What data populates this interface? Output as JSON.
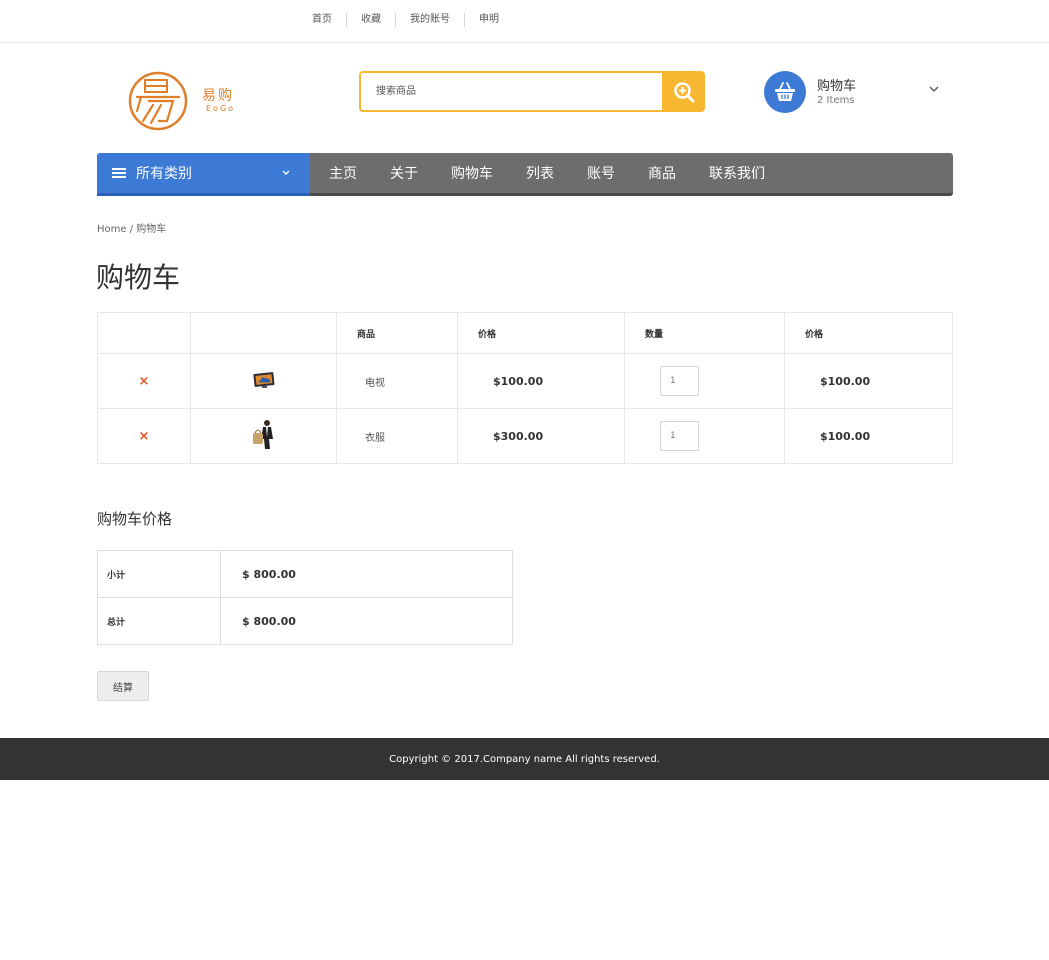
{
  "topbar": {
    "links": [
      "首页",
      "收藏",
      "我的账号",
      "申明"
    ]
  },
  "logo": {
    "cn": "易购",
    "en": "EoGo",
    "brand_color": "#e07f2a"
  },
  "search": {
    "placeholder": "搜索商品",
    "icon": "search-plus-icon",
    "accent": "#f7b731"
  },
  "cart_widget": {
    "title": "购物车",
    "count": "2 Items",
    "icon": "basket-icon",
    "accent": "#3c7ad6"
  },
  "nav": {
    "category_label": "所有类别",
    "items": [
      "主页",
      "关于",
      "购物车",
      "列表",
      "账号",
      "商品",
      "联系我们"
    ]
  },
  "breadcrumb": "Home / 购物车",
  "page_title": "购物车",
  "cart_table": {
    "headers": [
      "",
      "",
      "商品",
      "价格",
      "数量",
      "价格"
    ],
    "rows": [
      {
        "remove": "×",
        "name": "电视",
        "price": "$100.00",
        "qty": "1",
        "subtotal": "$100.00",
        "thumb": "tv-thumbnail"
      },
      {
        "remove": "×",
        "name": "衣服",
        "price": "$300.00",
        "qty": "1",
        "subtotal": "$100.00",
        "thumb": "clothes-thumbnail"
      }
    ]
  },
  "totals": {
    "title": "购物车价格",
    "rows": [
      {
        "label": "小计",
        "value": "$ 800.00"
      },
      {
        "label": "总计",
        "value": "$ 800.00"
      }
    ]
  },
  "checkout_label": "结算",
  "footer": {
    "text": "Copyright © 2017.Company name All rights reserved."
  }
}
